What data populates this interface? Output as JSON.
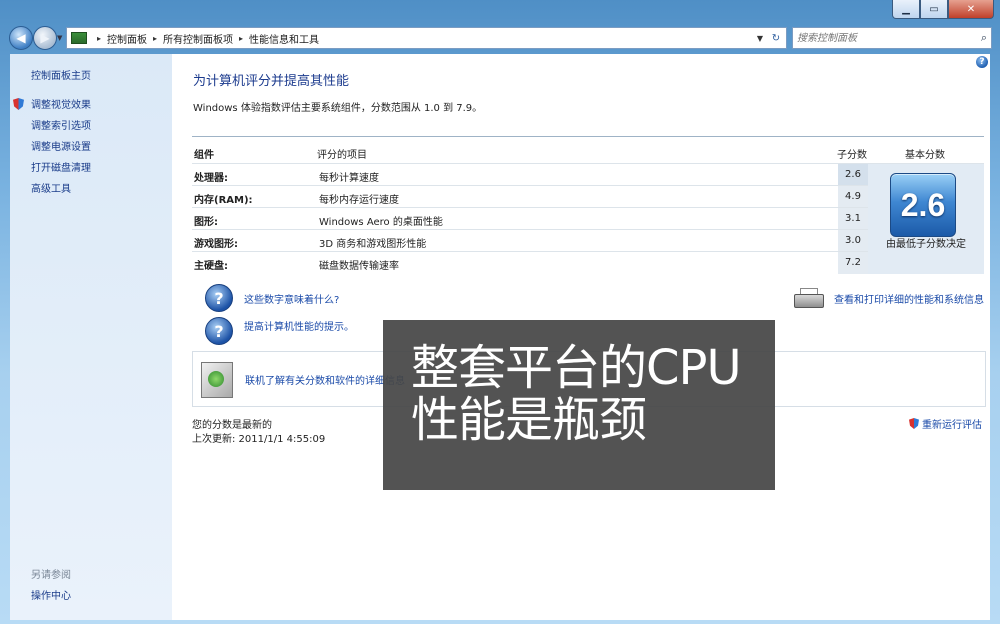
{
  "window": {
    "minimize_glyph": "▁",
    "maximize_glyph": "▭",
    "close_glyph": "✕"
  },
  "nav": {
    "back_glyph": "◀",
    "forward_glyph": "▶",
    "history_glyph": "▼",
    "breadcrumb": [
      "控制面板",
      "所有控制面板项",
      "性能信息和工具"
    ],
    "breadcrumb_sep": "▸",
    "address_dropdown_glyph": "▼",
    "refresh_glyph": "↻",
    "search_placeholder": "搜索控制面板",
    "search_icon_glyph": "⌕"
  },
  "sidebar": {
    "home": "控制面板主页",
    "links": [
      "调整视觉效果",
      "调整索引选项",
      "调整电源设置",
      "打开磁盘清理",
      "高级工具"
    ],
    "see_also": "另请参阅",
    "action_center": "操作中心"
  },
  "main": {
    "help_glyph": "?",
    "title": "为计算机评分并提高其性能",
    "description": "Windows 体验指数评估主要系统组件，分数范围从 1.0 到 7.9。",
    "table": {
      "headers": {
        "component": "组件",
        "rated": "评分的项目",
        "subscore": "子分数",
        "basescore": "基本分数"
      },
      "rows": [
        {
          "component": "处理器:",
          "desc": "每秒计算速度",
          "score": "2.6"
        },
        {
          "component": "内存(RAM):",
          "desc": "每秒内存运行速度",
          "score": "4.9"
        },
        {
          "component": "图形:",
          "desc": "Windows Aero 的桌面性能",
          "score": "3.1"
        },
        {
          "component": "游戏图形:",
          "desc": "3D 商务和游戏图形性能",
          "score": "3.0"
        },
        {
          "component": "主硬盘:",
          "desc": "磁盘数据传输速率",
          "score": "7.2"
        }
      ],
      "base_score": "2.6",
      "base_caption": "由最低子分数决定"
    },
    "links": {
      "q_glyph": "?",
      "what_mean": "这些数字意味着什么?",
      "tips": "提高计算机性能的提示。",
      "print_details": "查看和打印详细的性能和系统信息",
      "online": "联机了解有关分数和软件的详细信息"
    },
    "status": {
      "line1": "您的分数是最新的",
      "line2": "上次更新: 2011/1/1 4:55:09",
      "rerun": "重新运行评估"
    }
  },
  "overlay": {
    "line1": "整套平台的CPU",
    "line2": "性能是瓶颈"
  }
}
